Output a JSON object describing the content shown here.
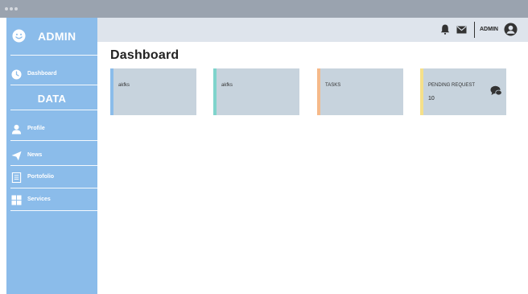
{
  "sidebar": {
    "brand": "ADMIN",
    "section_title": "DATA",
    "items": [
      {
        "label": "Dashboard",
        "icon": "dashboard-icon"
      },
      {
        "label": "Profile",
        "icon": "user-icon"
      },
      {
        "label": "News",
        "icon": "send-icon"
      },
      {
        "label": "Portofolio",
        "icon": "document-icon"
      },
      {
        "label": "Services",
        "icon": "grid-icon"
      }
    ]
  },
  "header": {
    "user_label": "ADMIN",
    "icons": [
      "bell-icon",
      "mail-icon",
      "user-avatar-icon"
    ]
  },
  "main": {
    "title": "Dashboard",
    "cards": [
      {
        "label": "akfks",
        "value": "",
        "accent": "#8bbcea"
      },
      {
        "label": "akfks",
        "value": "",
        "accent": "#7fd4cc"
      },
      {
        "label": "TASKS",
        "value": "",
        "accent": "#f5b98a"
      },
      {
        "label": "PENDING REQUEST",
        "value": "10",
        "accent": "#f5e08a",
        "icon": "chat-icon"
      }
    ]
  },
  "colors": {
    "sidebar_bg": "#8bbcea",
    "topbar_bg": "#dee4ec",
    "card_bg": "#c7d3dd",
    "titlebar_bg": "#9aa3af"
  }
}
